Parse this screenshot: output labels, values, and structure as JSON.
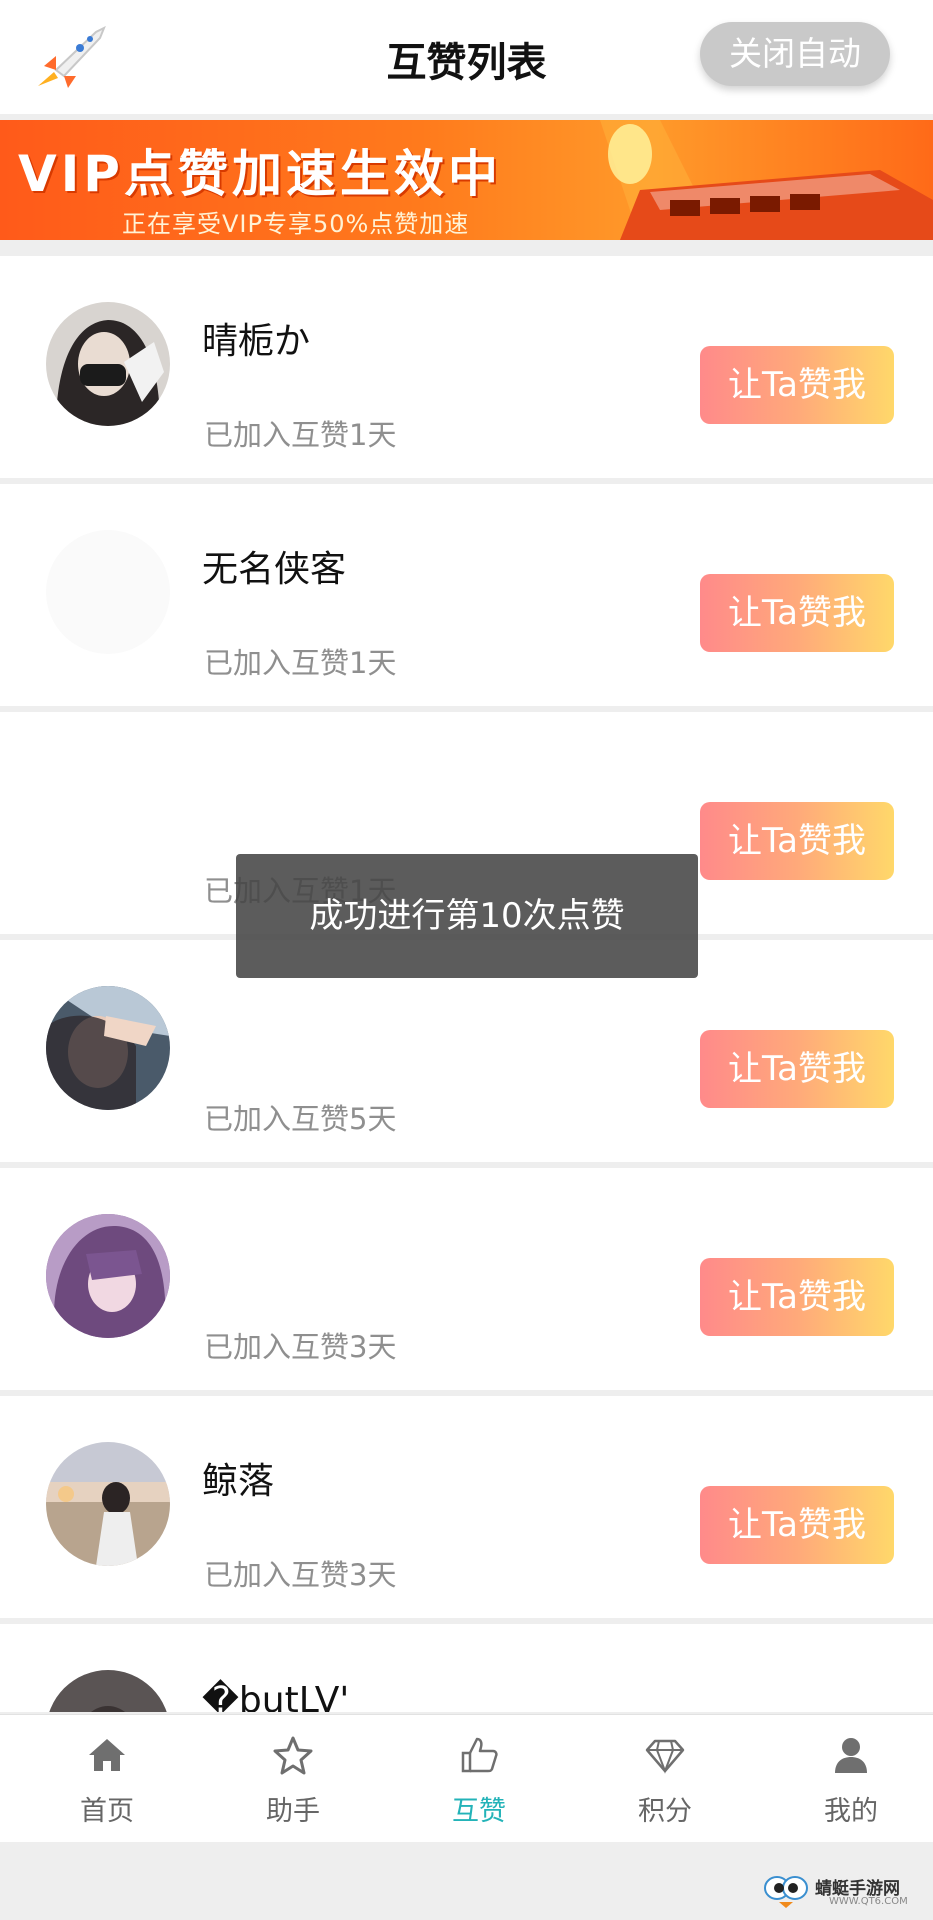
{
  "header": {
    "title": "互赞列表",
    "close_auto_label": "关闭自动"
  },
  "banner": {
    "title": "VIP点赞加速生效中",
    "subtitle": "正在享受VIP专享50%点赞加速"
  },
  "items": [
    {
      "name": "晴栀か",
      "joined": "已加入互赞1天",
      "button": "让Ta赞我"
    },
    {
      "name": "无名侠客",
      "joined": "已加入互赞1天",
      "button": "让Ta赞我"
    },
    {
      "name": "",
      "joined": "已加入互赞1天",
      "button": "让Ta赞我"
    },
    {
      "name": "",
      "joined": "已加入互赞5天",
      "button": "让Ta赞我"
    },
    {
      "name": "",
      "joined": "已加入互赞3天",
      "button": "让Ta赞我"
    },
    {
      "name": "鲸落",
      "joined": "已加入互赞3天",
      "button": "让Ta赞我"
    },
    {
      "name": "�butLV'",
      "joined": "",
      "button": ""
    }
  ],
  "toast": "成功进行第10次点赞",
  "nav": [
    {
      "label": "首页",
      "icon": "home-icon"
    },
    {
      "label": "助手",
      "icon": "star-icon"
    },
    {
      "label": "互赞",
      "icon": "thumbs-up-icon",
      "active": true
    },
    {
      "label": "积分",
      "icon": "diamond-icon"
    },
    {
      "label": "我的",
      "icon": "user-icon"
    }
  ],
  "watermark": {
    "text": "蜻蜓手游网",
    "url": "WWW.QT6.COM"
  },
  "colors": {
    "accent": "#23b3b8",
    "button_gradient_start": "#ff8a8a",
    "button_gradient_end": "#ffd86a"
  }
}
